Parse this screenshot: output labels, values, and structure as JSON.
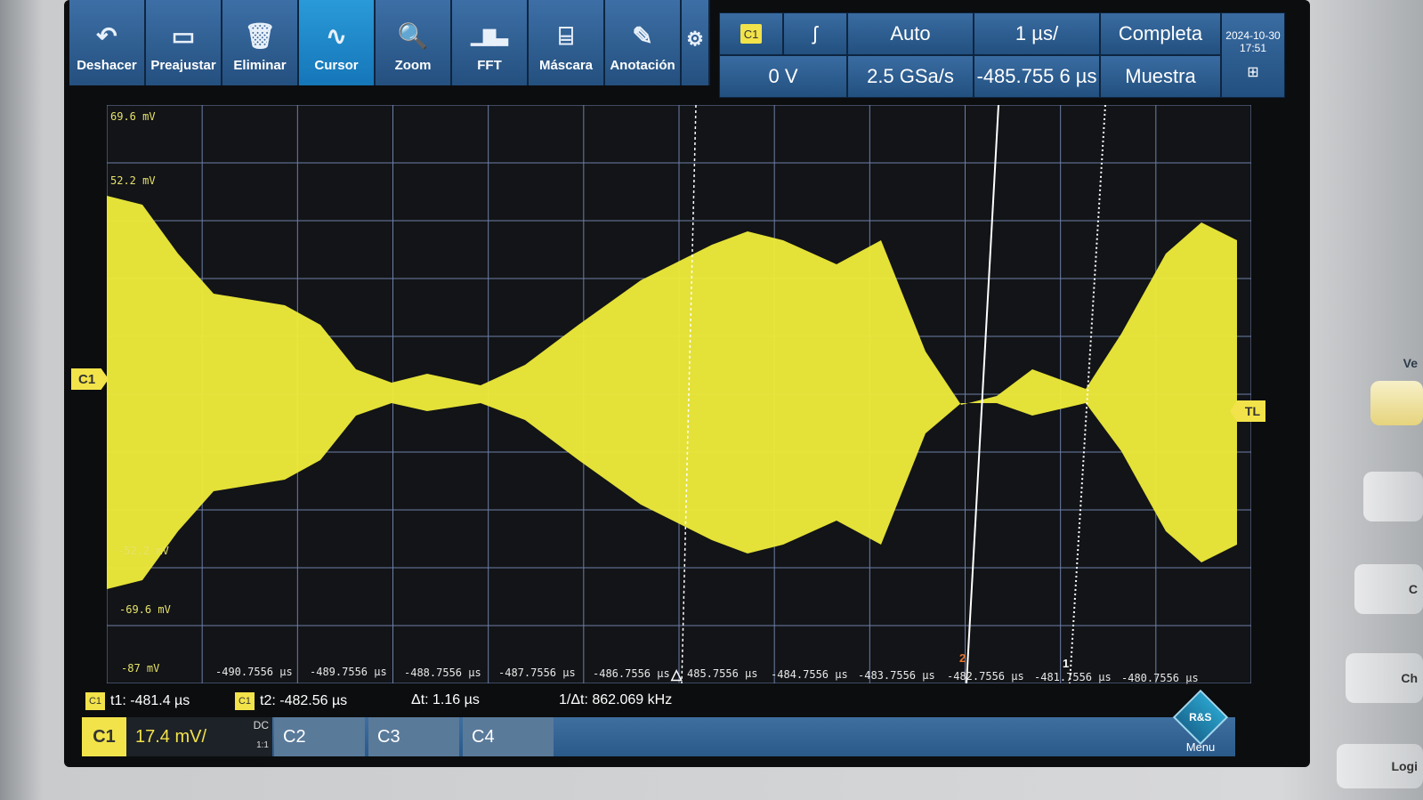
{
  "toolbar": [
    {
      "label": "Deshacer",
      "icon": "undo-icon",
      "glyph": "↶"
    },
    {
      "label": "Preajustar",
      "icon": "preset-icon",
      "glyph": "▭"
    },
    {
      "label": "Eliminar",
      "icon": "trash-icon",
      "glyph": "🗑"
    },
    {
      "label": "Cursor",
      "icon": "cursor-wave-icon",
      "glyph": "∿"
    },
    {
      "label": "Zoom",
      "icon": "zoom-icon",
      "glyph": "🔍"
    },
    {
      "label": "FFT",
      "icon": "fft-icon",
      "glyph": "▁▇▃"
    },
    {
      "label": "Máscara",
      "icon": "mask-icon",
      "glyph": "⌸"
    },
    {
      "label": "Anotación",
      "icon": "pencil-icon",
      "glyph": "✎"
    }
  ],
  "status": {
    "trigger_source": "C1",
    "trigger_level": "0 V",
    "trigger_mode": "Auto",
    "sample_rate": "2.5 GSa/s",
    "timebase": "1 µs/",
    "horizontal_position": "-485.755 6 µs",
    "acquisition": "Completa",
    "acquisition_mode": "Muestra",
    "date": "2024-10-30",
    "time": "17:51"
  },
  "plot": {
    "y_labels": [
      "69.6 mV",
      "52.2 mV",
      "-52.2 mV",
      "-69.6 mV",
      "-87 mV"
    ],
    "x_labels": [
      "-490.7556 µs",
      "-489.7556 µs",
      "-488.7556 µs",
      "-487.7556 µs",
      "-486.7556 µs",
      "485.7556 µs",
      "-484.7556 µs",
      "-483.7556 µs",
      "-482.7556 µs",
      "-481.7556 µs",
      "-480.7556 µs"
    ],
    "channel_tag": "C1",
    "trigger_tag": "TL",
    "cursor2_label": "2",
    "cursor1_label": "1",
    "wave_color": "#f0ec3a"
  },
  "readout": {
    "t1_badge": "C1",
    "t1": "t1: -481.4 µs",
    "t2_badge": "C1",
    "t2": "t2: -482.56 µs",
    "dt": "Δt: 1.16 µs",
    "inv_dt": "1/Δt: 862.069 kHz"
  },
  "channels": {
    "c1": "C1",
    "c1_scale": "17.4 mV/",
    "c1_coupling": "DC",
    "c1_probe": "1:1",
    "c2": "C2",
    "c3": "C3",
    "c4": "C4",
    "menu": "Menu"
  },
  "side_buttons": [
    "Ve",
    "C",
    "Ch",
    "Logi"
  ]
}
